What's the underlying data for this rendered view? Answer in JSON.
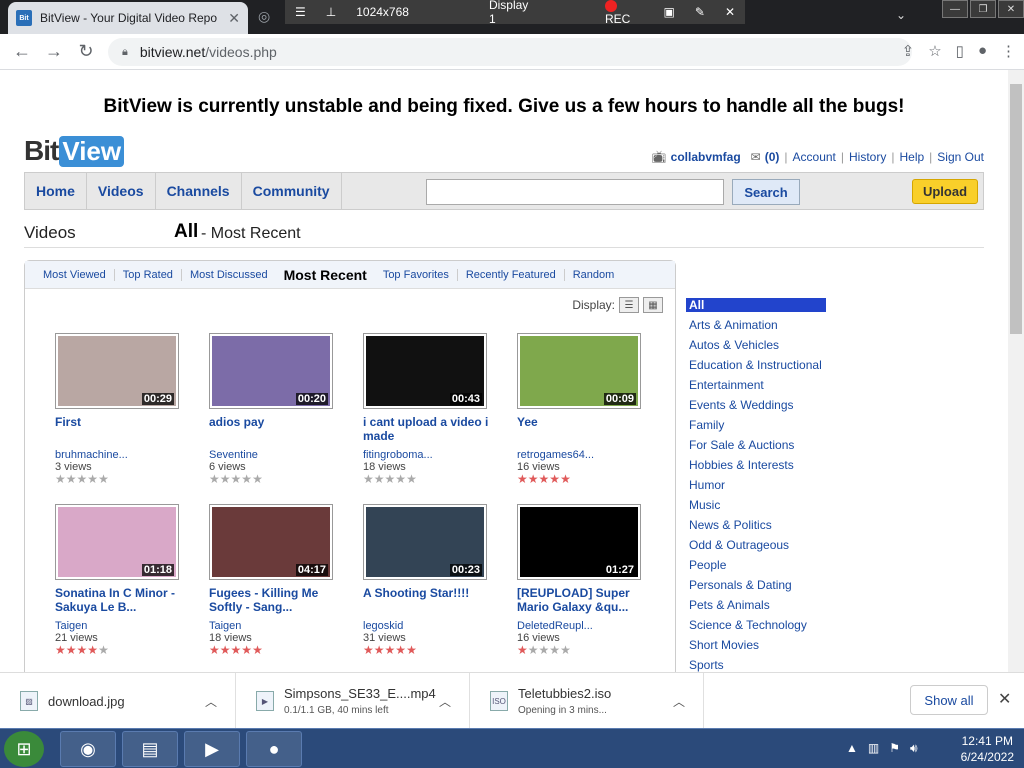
{
  "browser": {
    "tab_title": "BitView - Your Digital Video Repo",
    "favicon_text": "Bit",
    "recorder": {
      "resolution": "1024x768",
      "display": "Display 1",
      "rec_label": "REC"
    },
    "url_host": "bitview.net",
    "url_path": "/videos.php"
  },
  "page": {
    "banner": "BitView is currently unstable and being fixed. Give us a few hours to handle all the bugs!",
    "logo": {
      "bit": "Bit",
      "view": "View"
    },
    "user": {
      "name": "collabvmfag",
      "messages": "(0)",
      "links": [
        "Account",
        "History",
        "Help",
        "Sign Out"
      ]
    },
    "nav": [
      "Home",
      "Videos",
      "Channels",
      "Community"
    ],
    "search": {
      "button": "Search",
      "value": ""
    },
    "upload_label": "Upload",
    "section": {
      "title": "Videos",
      "category": "All",
      "subtitle": " - Most Recent"
    },
    "sort_tabs": [
      "Most Viewed",
      "Top Rated",
      "Most Discussed",
      "Most Recent",
      "Top Favorites",
      "Recently Featured",
      "Random"
    ],
    "display_label": "Display:",
    "videos": [
      {
        "title": "First",
        "user": "bruhmachine...",
        "views": "3 views",
        "duration": "00:29",
        "rating": 0,
        "thumb": "#b9a7a3"
      },
      {
        "title": "adios pay",
        "user": "Seventine",
        "views": "6 views",
        "duration": "00:20",
        "rating": 0,
        "thumb": "#7c6ca8"
      },
      {
        "title": "i cant upload a video i made",
        "user": "fitingroboma...",
        "views": "18 views",
        "duration": "00:43",
        "rating": 0,
        "thumb": "#111111"
      },
      {
        "title": "Yee",
        "user": "retrogames64...",
        "views": "16 views",
        "duration": "00:09",
        "rating": 5,
        "thumb": "#7fa84c"
      },
      {
        "title": "Sonatina In C Minor - Sakuya Le B...",
        "user": "Taigen",
        "views": "21 views",
        "duration": "01:18",
        "rating": 4.5,
        "thumb": "#d9a8c8"
      },
      {
        "title": "Fugees - Killing Me Softly - Sang...",
        "user": "Taigen",
        "views": "18 views",
        "duration": "04:17",
        "rating": 5,
        "thumb": "#6a3a3a"
      },
      {
        "title": "A Shooting Star!!!!",
        "user": "legoskid",
        "views": "31 views",
        "duration": "00:23",
        "rating": 5,
        "thumb": "#334455"
      },
      {
        "title": "[REUPLOAD] Super Mario Galaxy &qu...",
        "user": "DeletedReupl...",
        "views": "16 views",
        "duration": "01:27",
        "rating": 1,
        "thumb": "#000000"
      }
    ],
    "categories": [
      "All",
      "Arts & Animation",
      "Autos & Vehicles",
      "Education & Instructional",
      "Entertainment",
      "Events & Weddings",
      "Family",
      "For Sale & Auctions",
      "Hobbies & Interests",
      "Humor",
      "Music",
      "News & Politics",
      "Odd & Outrageous",
      "People",
      "Personals & Dating",
      "Pets & Animals",
      "Science & Technology",
      "Short Movies",
      "Sports"
    ]
  },
  "downloads": {
    "items": [
      {
        "name": "download.jpg",
        "sub": ""
      },
      {
        "name": "Simpsons_SE33_E....mp4",
        "sub": "0.1/1.1 GB, 40 mins left"
      },
      {
        "name": "Teletubbies2.iso",
        "sub": "Opening in 3 mins..."
      }
    ],
    "show_all": "Show all"
  },
  "taskbar": {
    "time": "12:41 PM",
    "date": "6/24/2022"
  }
}
